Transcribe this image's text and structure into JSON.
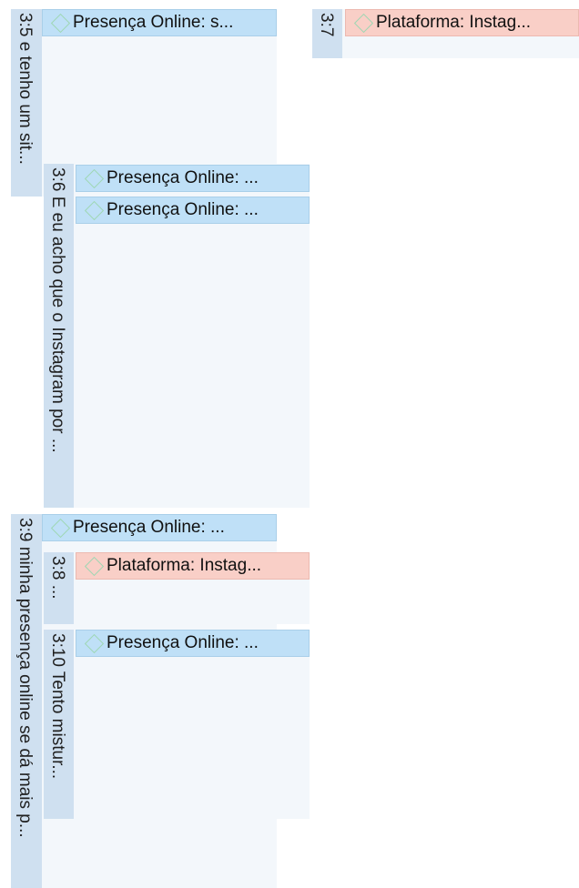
{
  "colors": {
    "code_blue": "#bfe0f7",
    "code_pink": "#f9cfc7",
    "quote_label": "#cfe0f0",
    "quote_body": "#f3f7fb",
    "diamond": "#9ed7b3"
  },
  "quotes": {
    "q3_5": "3:5 e tenho um sit...",
    "q3_6": "3:6 E eu acho que o Instagram por ...",
    "q3_7": "3:7",
    "q3_8": "3:8 ...",
    "q3_9": "3:9 minha presença online se dá mais p...",
    "q3_10": "3:10 Tento mistur..."
  },
  "codes": {
    "c1": {
      "label": "Presença Online: s...",
      "icon": "code-diamond-icon"
    },
    "c2": {
      "label": "Presença Online: ...",
      "icon": "code-diamond-icon"
    },
    "c3": {
      "label": "Presença Online: ...",
      "icon": "code-diamond-icon"
    },
    "c4": {
      "label": "Plataforma: Instag...",
      "icon": "code-diamond-icon"
    },
    "c5": {
      "label": "Presença Online: ...",
      "icon": "code-diamond-icon"
    },
    "c6": {
      "label": "Plataforma: Instag...",
      "icon": "code-diamond-icon"
    },
    "c7": {
      "label": "Presença Online: ...",
      "icon": "code-diamond-icon"
    }
  }
}
